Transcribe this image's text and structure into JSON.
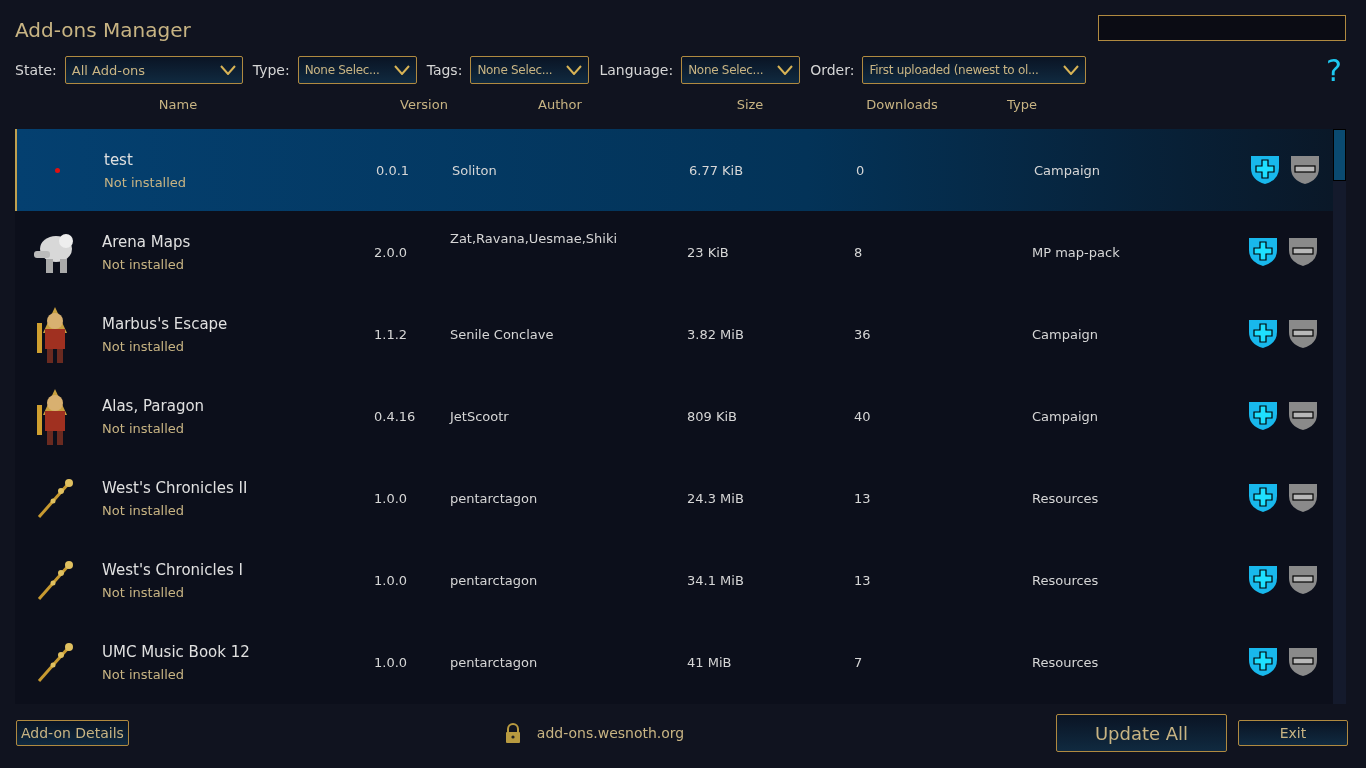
{
  "title": "Add-ons Manager",
  "filters": [
    {
      "label": "State:",
      "value": "All Add-ons"
    },
    {
      "label": "Type:",
      "value": "None Selec..."
    },
    {
      "label": "Tags:",
      "value": "None Selec..."
    },
    {
      "label": "Language:",
      "value": "None Selec..."
    },
    {
      "label": "Order:",
      "value": "First uploaded (newest to ol..."
    }
  ],
  "help": "?",
  "columns": [
    "Name",
    "Version",
    "Author",
    "Size",
    "Downloads",
    "Type"
  ],
  "addons": [
    {
      "kind": "dot",
      "name": "test",
      "status": "Not installed",
      "version": "0.0.1",
      "author": "Soliton",
      "size": "6.77 KiB",
      "downloads": "0",
      "type": "Campaign",
      "selected": true
    },
    {
      "kind": "creature",
      "name": "Arena Maps",
      "status": "Not installed",
      "version": "2.0.0",
      "author": "Zat,Ravana,Uesmae,Shiki",
      "size": "23 KiB",
      "downloads": "8",
      "type": "MP map-pack",
      "selected": false
    },
    {
      "kind": "warrior",
      "name": "Marbus's Escape",
      "status": "Not installed",
      "version": "1.1.2",
      "author": "Senile Conclave",
      "size": "3.82 MiB",
      "downloads": "36",
      "type": "Campaign",
      "selected": false
    },
    {
      "kind": "warrior",
      "name": "Alas, Paragon",
      "status": "Not installed",
      "version": "0.4.16",
      "author": "JetScootr",
      "size": "809 KiB",
      "downloads": "40",
      "type": "Campaign",
      "selected": false
    },
    {
      "kind": "staff",
      "name": "West's Chronicles II",
      "status": "Not installed",
      "version": "1.0.0",
      "author": "pentarctagon",
      "size": "24.3 MiB",
      "downloads": "13",
      "type": "Resources",
      "selected": false
    },
    {
      "kind": "staff",
      "name": "West's Chronicles I",
      "status": "Not installed",
      "version": "1.0.0",
      "author": "pentarctagon",
      "size": "34.1 MiB",
      "downloads": "13",
      "type": "Resources",
      "selected": false
    },
    {
      "kind": "staff",
      "name": "UMC Music Book 12",
      "status": "Not installed",
      "version": "1.0.0",
      "author": "pentarctagon",
      "size": "41 MiB",
      "downloads": "7",
      "type": "Resources",
      "selected": false
    }
  ],
  "details_button": "Add-on Details",
  "server": "add-ons.wesnoth.org",
  "update_button": "Update All",
  "exit_button": "Exit"
}
